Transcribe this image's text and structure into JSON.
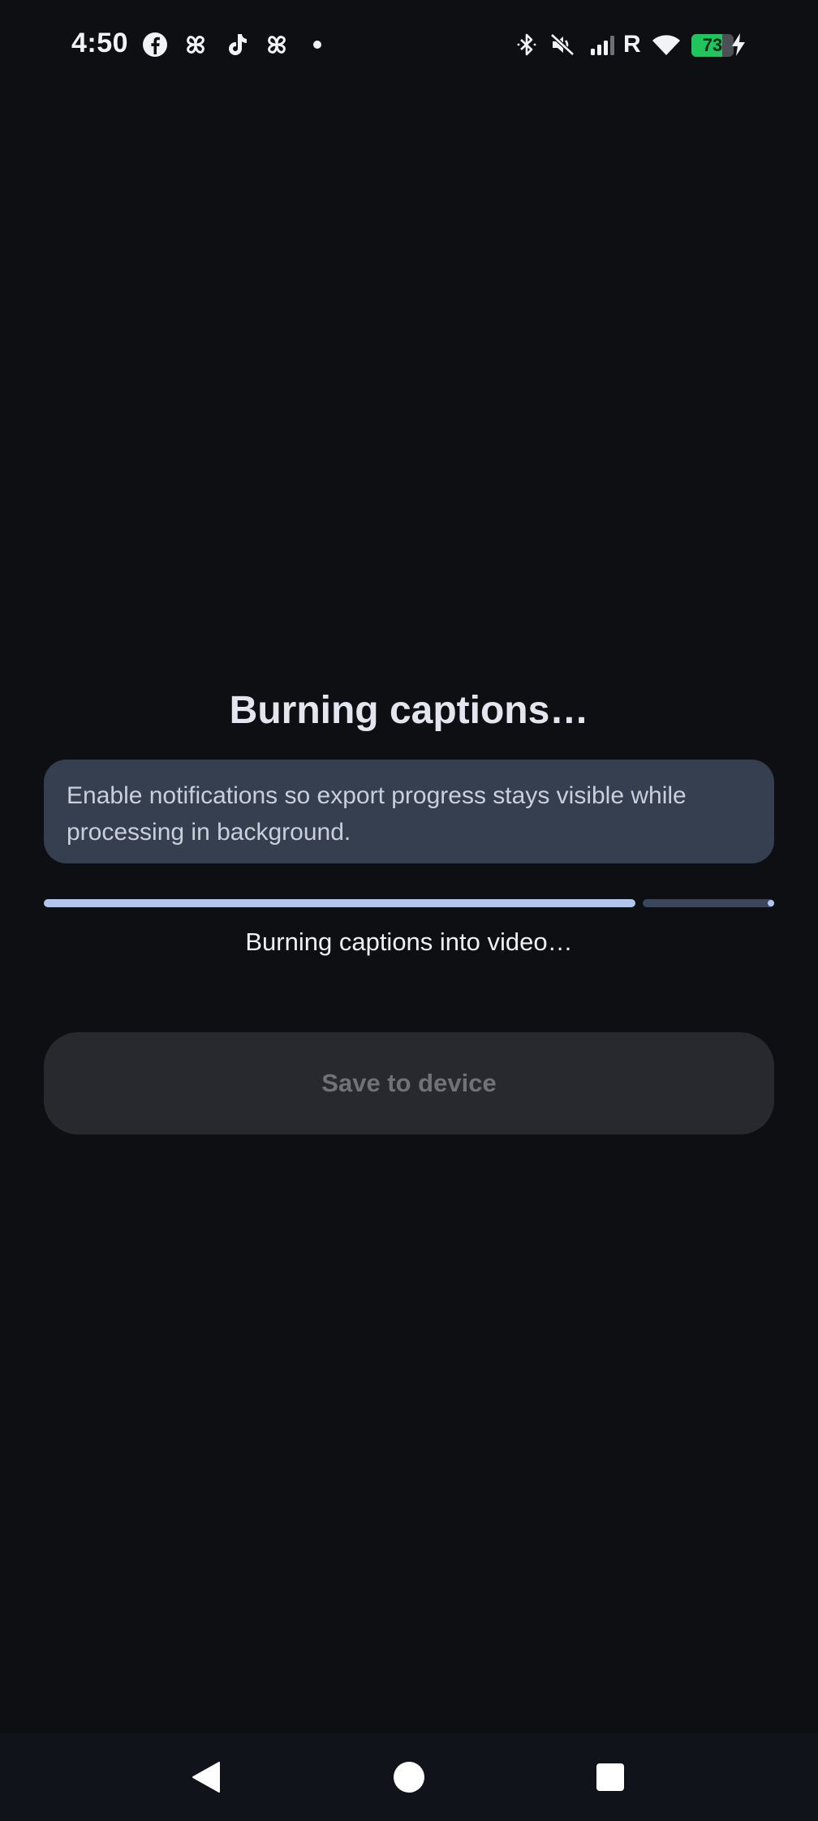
{
  "status_bar": {
    "time": "4:50",
    "notification_icons": [
      "facebook-icon",
      "pinwheel-icon",
      "tiktok-icon",
      "pinwheel-icon",
      "dot-icon"
    ],
    "system_icons": [
      "bluetooth-icon",
      "muted-icon",
      "signal-icon",
      "wifi-icon"
    ],
    "roaming_label": "R",
    "battery_level": "73",
    "battery_fraction": 0.73,
    "charging": true
  },
  "export": {
    "title": "Burning captions…",
    "notice": "Enable notifications so export progress stays visible while processing in background.",
    "progress_fraction": 0.81,
    "status_text": "Burning captions into video…",
    "save_label": "Save to device"
  },
  "navigation": {
    "icons": [
      "back-icon",
      "home-icon",
      "recents-icon"
    ]
  },
  "colors": {
    "background": "#0e0f13",
    "notice_background": "#363f50",
    "progress_fill": "#b2c5ee",
    "progress_track": "#3a465c",
    "button_disabled": "#28292e",
    "battery_green": "#21c55d"
  }
}
